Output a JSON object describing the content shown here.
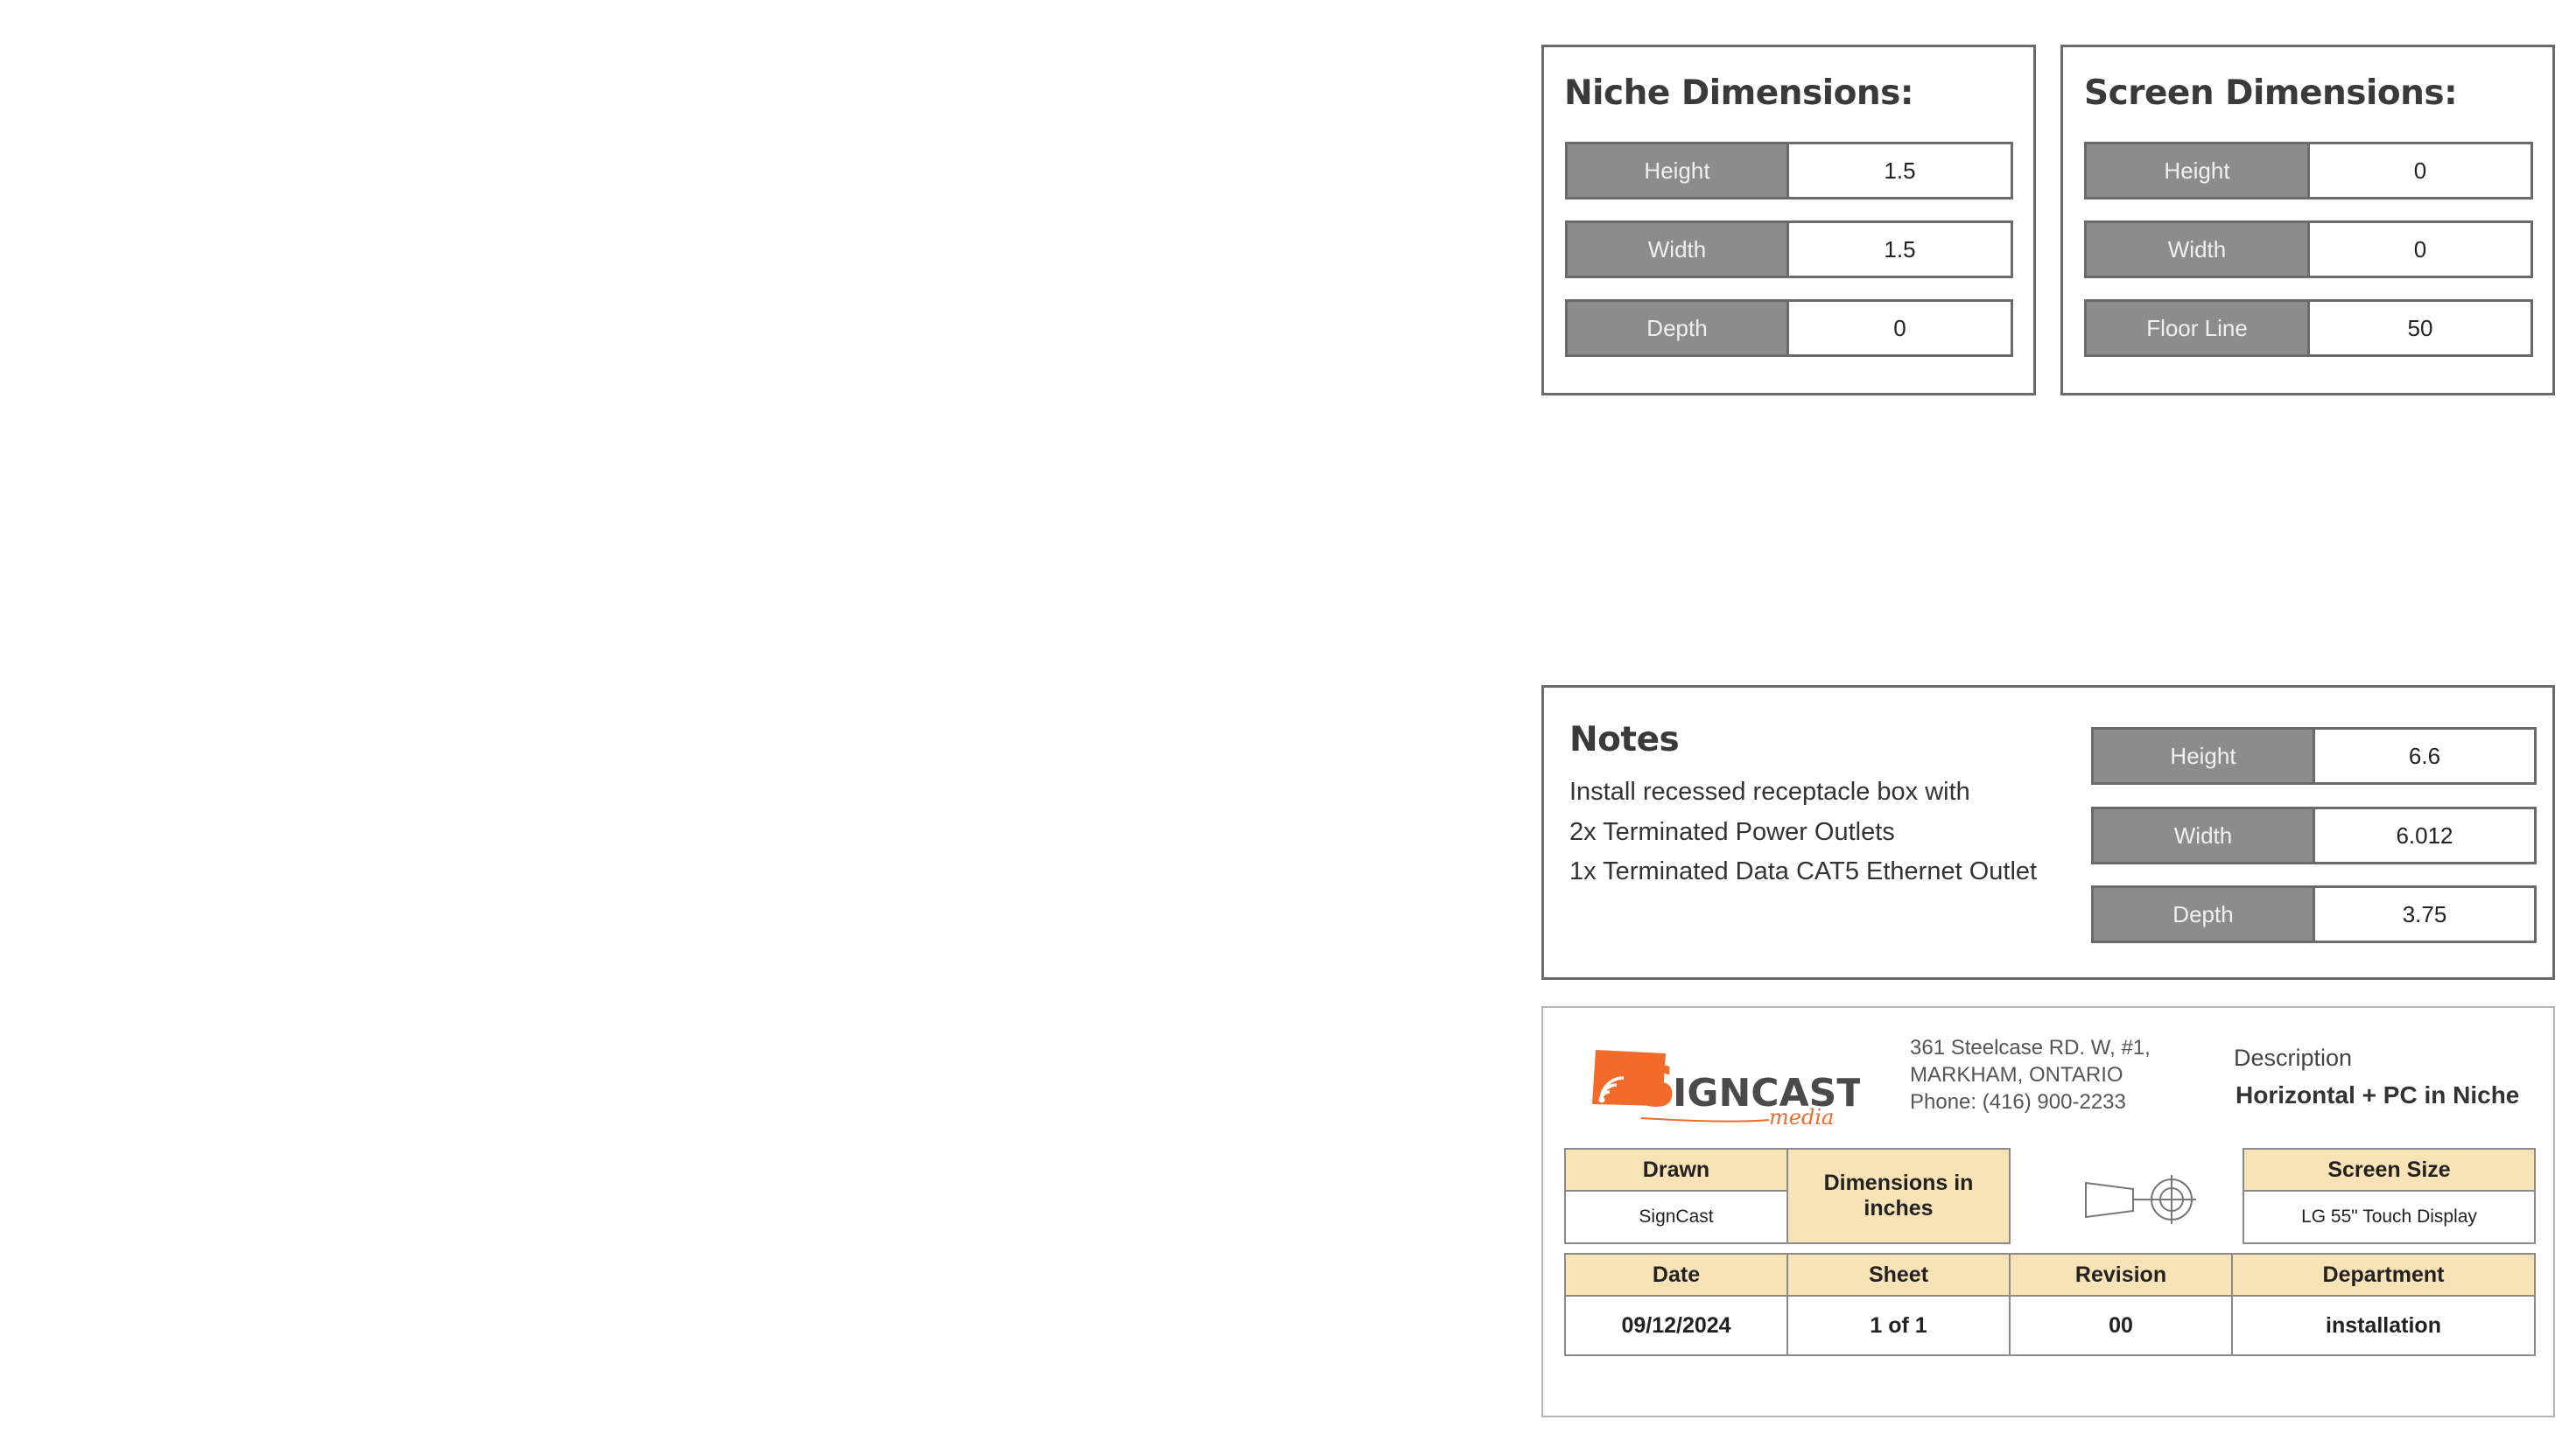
{
  "niche_panel": {
    "title": "Niche Dimensions:",
    "rows": [
      {
        "label": "Height",
        "value": "1.5"
      },
      {
        "label": "Width",
        "value": "1.5"
      },
      {
        "label": "Depth",
        "value": "0"
      }
    ]
  },
  "screen_panel": {
    "title": "Screen Dimensions:",
    "rows": [
      {
        "label": "Height",
        "value": "0"
      },
      {
        "label": "Width",
        "value": "0"
      },
      {
        "label": "Floor Line",
        "value": "50"
      }
    ]
  },
  "notes_panel": {
    "title": "Notes",
    "lines": [
      "Install recessed receptacle box with",
      "2x Terminated Power Outlets",
      "1x Terminated Data CAT5 Ethernet Outlet"
    ],
    "rows": [
      {
        "label": "Height",
        "value": "6.6"
      },
      {
        "label": "Width",
        "value": "6.012"
      },
      {
        "label": "Depth",
        "value": "3.75"
      }
    ]
  },
  "title_block": {
    "logo": {
      "brand": "SIGNCAST",
      "sub": "media",
      "brand_color": "#f26b2a",
      "dark_color": "#4a4a4a"
    },
    "address": [
      "361 Steelcase RD. W, #1,",
      "MARKHAM, ONTARIO",
      "Phone: (416) 900-2233"
    ],
    "description_label": "Description",
    "description_value": "Horizontal + PC in Niche",
    "drawn_label": "Drawn",
    "drawn_value": "SignCast",
    "dimensions_note": "Dimensions in inches",
    "projection_icon": "third-angle-projection-icon",
    "screen_size_label": "Screen Size",
    "screen_size_value": "LG 55\" Touch Display",
    "date_label": "Date",
    "date_value": "09/12/2024",
    "sheet_label": "Sheet",
    "sheet_value": "1 of 1",
    "revision_label": "Revision",
    "revision_value": "00",
    "department_label": "Department",
    "department_value": "installation",
    "header_color": "#f8e3b6"
  }
}
